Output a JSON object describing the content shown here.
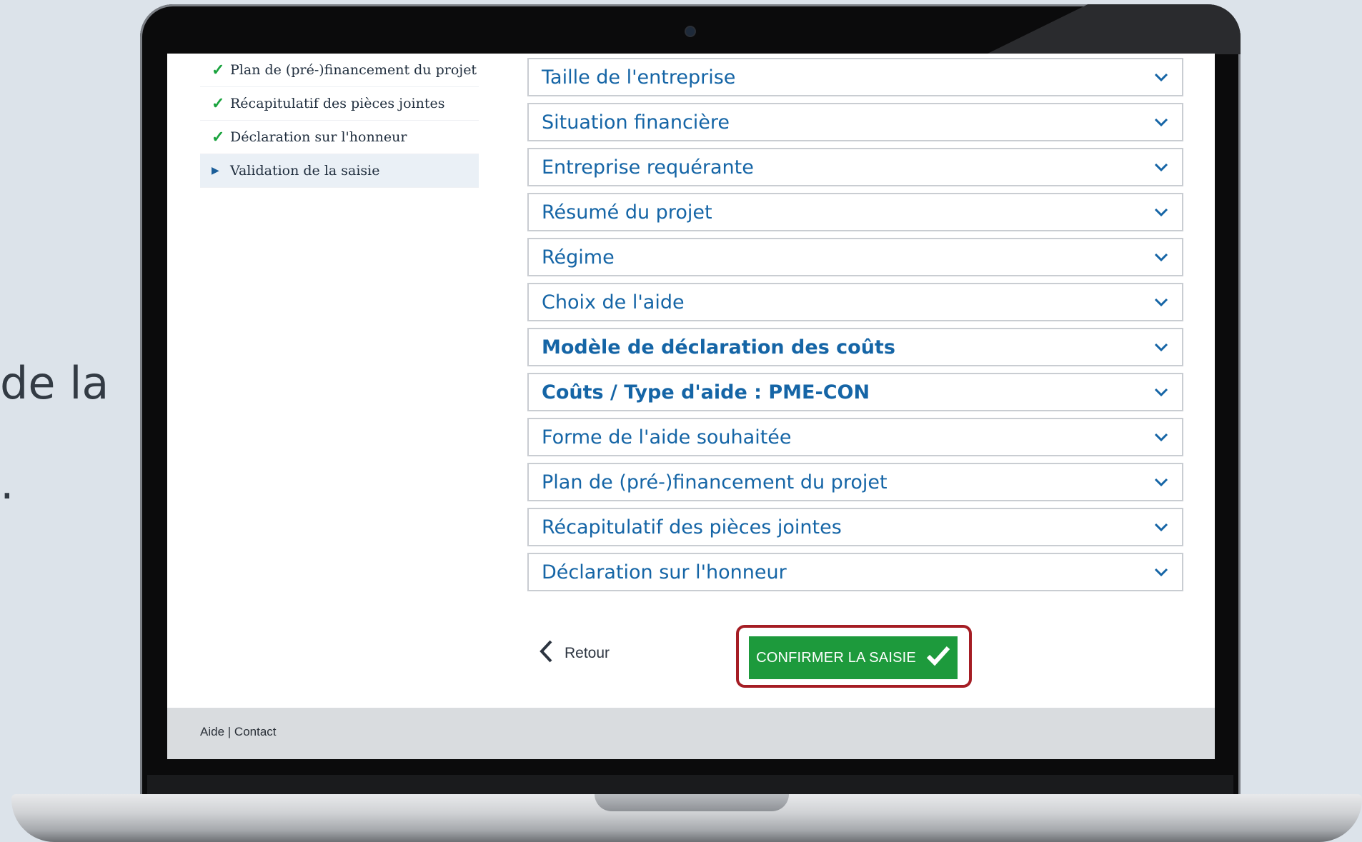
{
  "background_text": {
    "line1": "de la",
    "line2": "."
  },
  "sidebar": {
    "items": [
      {
        "label": "Plan de (pré-)financement du projet",
        "status": "done"
      },
      {
        "label": "Récapitulatif des pièces jointes",
        "status": "done"
      },
      {
        "label": "Déclaration sur l'honneur",
        "status": "done"
      },
      {
        "label": "Validation de la saisie",
        "status": "current"
      }
    ]
  },
  "accordion": {
    "items": [
      {
        "label": "Taille de l'entreprise"
      },
      {
        "label": "Situation financière"
      },
      {
        "label": "Entreprise requérante"
      },
      {
        "label": "Résumé du projet"
      },
      {
        "label": "Régime"
      },
      {
        "label": "Choix de l'aide"
      },
      {
        "label": "Modèle de déclaration des coûts"
      },
      {
        "label": "Coûts / Type d'aide : PME-CON"
      },
      {
        "label": "Forme de l'aide souhaitée"
      },
      {
        "label": "Plan de (pré-)financement du projet"
      },
      {
        "label": "Récapitulatif des pièces jointes"
      },
      {
        "label": "Déclaration sur l'honneur"
      }
    ]
  },
  "actions": {
    "back_label": "Retour",
    "confirm_label": "CONFIRMER LA SAISIE"
  },
  "footer": {
    "help": "Aide",
    "separator": "|",
    "contact": "Contact"
  },
  "colors": {
    "accent_blue": "#1565a6",
    "success_green": "#1d9a3c",
    "highlight_red": "#a51d24"
  }
}
